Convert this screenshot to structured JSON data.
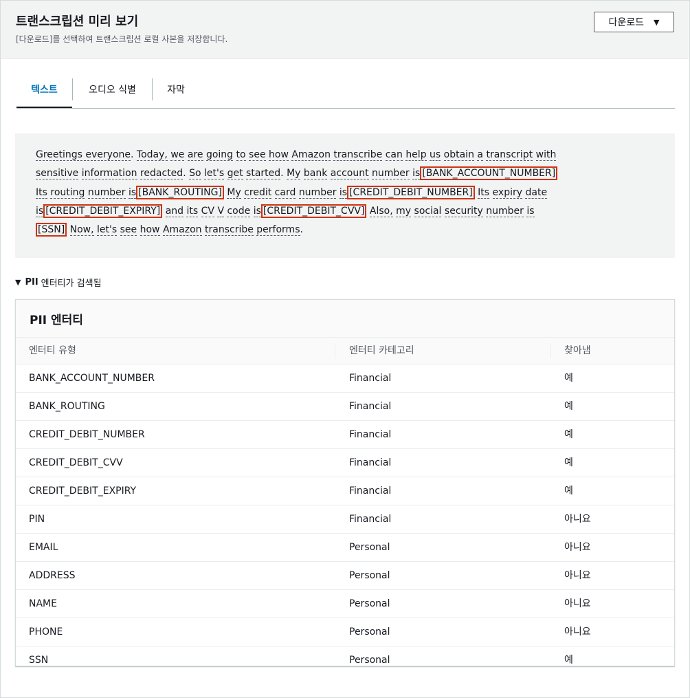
{
  "header": {
    "title": "트랜스크립션 미리 보기",
    "subtitle": "[다운로드]를 선택하여 트랜스크립션 로컬 사본을 저장합니다.",
    "download_label": "다운로드",
    "download_caret": "▼"
  },
  "tabs": [
    {
      "label": "텍스트",
      "active": true
    },
    {
      "label": "오디오 식별",
      "active": false
    },
    {
      "label": "자막",
      "active": false
    }
  ],
  "transcript": {
    "lines": [
      [
        {
          "t": "Greetings everyone"
        },
        {
          "t": ". ",
          "p": true
        },
        {
          "t": "Today,"
        },
        {
          "t": " ",
          "p": true
        },
        {
          "t": "we"
        },
        {
          "t": " ",
          "p": true
        },
        {
          "t": "are"
        },
        {
          "t": " ",
          "p": true
        },
        {
          "t": "going"
        },
        {
          "t": " ",
          "p": true
        },
        {
          "t": "to"
        },
        {
          "t": " ",
          "p": true
        },
        {
          "t": "see"
        },
        {
          "t": " ",
          "p": true
        },
        {
          "t": "how"
        },
        {
          "t": " ",
          "p": true
        },
        {
          "t": "Amazon"
        },
        {
          "t": " ",
          "p": true
        },
        {
          "t": "transcribe"
        },
        {
          "t": " ",
          "p": true
        },
        {
          "t": "can"
        },
        {
          "t": " ",
          "p": true
        },
        {
          "t": "help"
        },
        {
          "t": " ",
          "p": true
        },
        {
          "t": "us"
        },
        {
          "t": " ",
          "p": true
        },
        {
          "t": "obtain"
        },
        {
          "t": " ",
          "p": true
        },
        {
          "t": "a"
        },
        {
          "t": " ",
          "p": true
        },
        {
          "t": "transcript"
        },
        {
          "t": " ",
          "p": true
        },
        {
          "t": "with"
        }
      ],
      [
        {
          "t": "sensitive"
        },
        {
          "t": " ",
          "p": true
        },
        {
          "t": "information"
        },
        {
          "t": " ",
          "p": true
        },
        {
          "t": "redacted"
        },
        {
          "t": ". ",
          "p": true
        },
        {
          "t": "So"
        },
        {
          "t": " ",
          "p": true
        },
        {
          "t": "let's"
        },
        {
          "t": " ",
          "p": true
        },
        {
          "t": "get"
        },
        {
          "t": " ",
          "p": true
        },
        {
          "t": "started"
        },
        {
          "t": ". ",
          "p": true
        },
        {
          "t": "My"
        },
        {
          "t": " ",
          "p": true
        },
        {
          "t": "bank"
        },
        {
          "t": " ",
          "p": true
        },
        {
          "t": "account"
        },
        {
          "t": " ",
          "p": true
        },
        {
          "t": "number"
        },
        {
          "t": " ",
          "p": true
        },
        {
          "t": "is"
        },
        {
          "t": "[BANK_ACCOUNT_NUMBER]",
          "r": true
        }
      ],
      [
        {
          "t": "Its"
        },
        {
          "t": " ",
          "p": true
        },
        {
          "t": "routing"
        },
        {
          "t": " ",
          "p": true
        },
        {
          "t": "number"
        },
        {
          "t": " ",
          "p": true
        },
        {
          "t": "is"
        },
        {
          "t": "[BANK_ROUTING]",
          "r": true
        },
        {
          "t": " ",
          "p": true
        },
        {
          "t": "My"
        },
        {
          "t": " ",
          "p": true
        },
        {
          "t": "credit"
        },
        {
          "t": " ",
          "p": true
        },
        {
          "t": "card"
        },
        {
          "t": " ",
          "p": true
        },
        {
          "t": "number"
        },
        {
          "t": " ",
          "p": true
        },
        {
          "t": "is"
        },
        {
          "t": "[CREDIT_DEBIT_NUMBER]",
          "r": true
        },
        {
          "t": " ",
          "p": true
        },
        {
          "t": "Its"
        },
        {
          "t": " ",
          "p": true
        },
        {
          "t": "expiry"
        },
        {
          "t": " ",
          "p": true
        },
        {
          "t": "date"
        }
      ],
      [
        {
          "t": "is"
        },
        {
          "t": "[CREDIT_DEBIT_EXPIRY]",
          "r": true
        },
        {
          "t": " ",
          "p": true
        },
        {
          "t": "and"
        },
        {
          "t": " ",
          "p": true
        },
        {
          "t": "its"
        },
        {
          "t": " ",
          "p": true
        },
        {
          "t": "CV"
        },
        {
          "t": " ",
          "p": true
        },
        {
          "t": "V"
        },
        {
          "t": " ",
          "p": true
        },
        {
          "t": "code"
        },
        {
          "t": " ",
          "p": true
        },
        {
          "t": "is"
        },
        {
          "t": "[CREDIT_DEBIT_CVV]",
          "r": true
        },
        {
          "t": " ",
          "p": true
        },
        {
          "t": "Also,"
        },
        {
          "t": " ",
          "p": true
        },
        {
          "t": "my"
        },
        {
          "t": " ",
          "p": true
        },
        {
          "t": "social"
        },
        {
          "t": " ",
          "p": true
        },
        {
          "t": "security"
        },
        {
          "t": " ",
          "p": true
        },
        {
          "t": "number"
        },
        {
          "t": " ",
          "p": true
        },
        {
          "t": "is"
        }
      ],
      [
        {
          "t": "[SSN]",
          "r": true
        },
        {
          "t": " ",
          "p": true
        },
        {
          "t": "Now,"
        },
        {
          "t": " ",
          "p": true
        },
        {
          "t": "let's"
        },
        {
          "t": " ",
          "p": true
        },
        {
          "t": "see"
        },
        {
          "t": " ",
          "p": true
        },
        {
          "t": "how"
        },
        {
          "t": " ",
          "p": true
        },
        {
          "t": "Amazon"
        },
        {
          "t": " ",
          "p": true
        },
        {
          "t": "transcribe"
        },
        {
          "t": " ",
          "p": true
        },
        {
          "t": "performs"
        },
        {
          "t": ".",
          "p": true
        }
      ]
    ]
  },
  "pii_toggle": {
    "icon": "caret-down-icon",
    "label_bold": "PII",
    "label_rest": "엔터티가 검색됨"
  },
  "pii_panel": {
    "title": "PII 엔터티",
    "columns": [
      "엔터티 유형",
      "엔터티 카테고리",
      "찾아냄"
    ],
    "rows": [
      [
        "BANK_ACCOUNT_NUMBER",
        "Financial",
        "예"
      ],
      [
        "BANK_ROUTING",
        "Financial",
        "예"
      ],
      [
        "CREDIT_DEBIT_NUMBER",
        "Financial",
        "예"
      ],
      [
        "CREDIT_DEBIT_CVV",
        "Financial",
        "예"
      ],
      [
        "CREDIT_DEBIT_EXPIRY",
        "Financial",
        "예"
      ],
      [
        "PIN",
        "Financial",
        "아니요"
      ],
      [
        "EMAIL",
        "Personal",
        "아니요"
      ],
      [
        "ADDRESS",
        "Personal",
        "아니요"
      ],
      [
        "NAME",
        "Personal",
        "아니요"
      ],
      [
        "PHONE",
        "Personal",
        "아니요"
      ],
      [
        "SSN",
        "Personal",
        "예"
      ]
    ]
  },
  "colors": {
    "accent": "#0073bb",
    "redaction_border": "#d13212",
    "header_bg": "#f2f3f3"
  }
}
